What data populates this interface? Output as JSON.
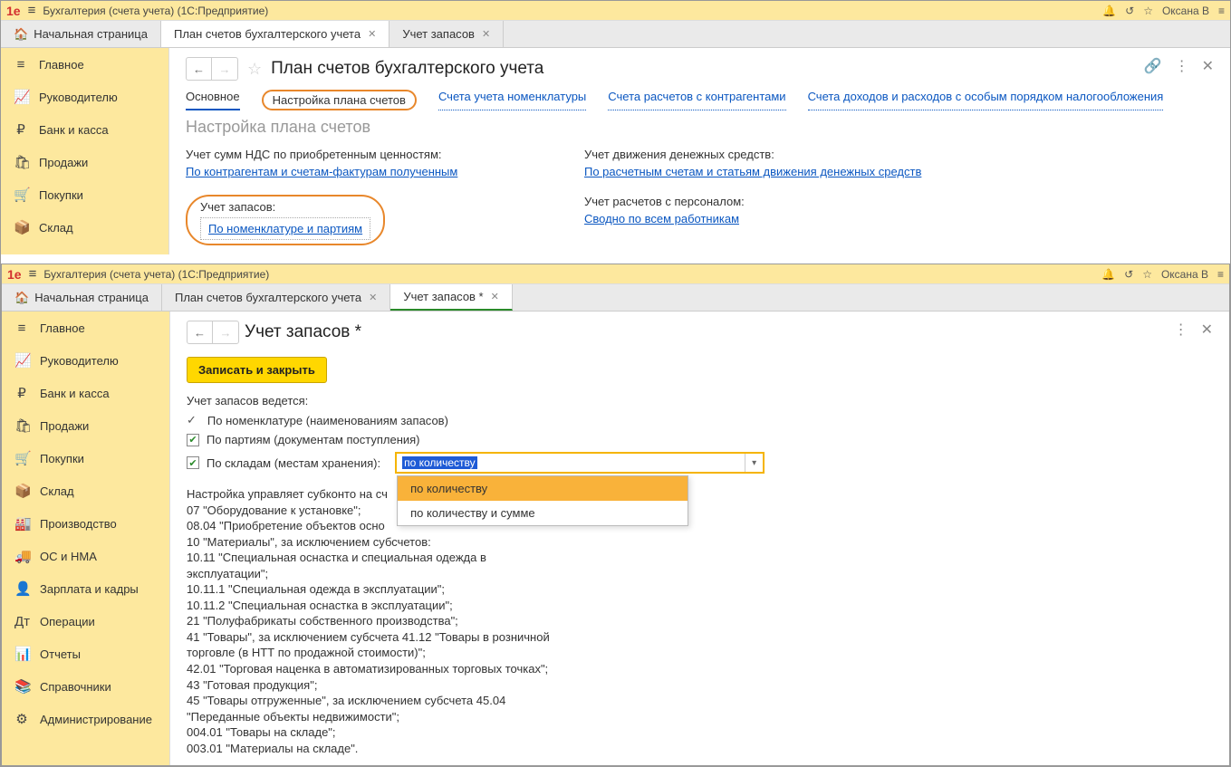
{
  "app": {
    "title": "Бухгалтерия (счета учета)  (1С:Предприятие)",
    "user": "Оксана В"
  },
  "tabs": {
    "home": "Начальная страница",
    "t1": "План счетов бухгалтерского учета",
    "t2": "Учет запасов",
    "t2_mod": "Учет запасов *"
  },
  "sidebar": {
    "main": "Главное",
    "manager": "Руководителю",
    "bank": "Банк и касса",
    "sales": "Продажи",
    "purch": "Покупки",
    "warehouse": "Склад",
    "prod": "Производство",
    "os": "ОС и НМА",
    "salary": "Зарплата и кадры",
    "ops": "Операции",
    "reports": "Отчеты",
    "refs": "Справочники",
    "admin": "Администрирование"
  },
  "page1": {
    "title": "План счетов бухгалтерского учета",
    "subnav": {
      "main": "Основное",
      "setup": "Настройка плана счетов",
      "nomen": "Счета учета номенклатуры",
      "contr": "Счета расчетов с контрагентами",
      "tax": "Счета доходов и расходов с особым порядком налогообложения"
    },
    "section_title": "Настройка плана счетов",
    "nds_label": "Учет сумм НДС по приобретенным ценностям:",
    "nds_link": "По контрагентам и счетам-фактурам полученным",
    "cash_label": "Учет движения денежных средств:",
    "cash_link": "По расчетным счетам и статьям движения денежных средств",
    "stock_label": "Учет запасов:",
    "stock_link": "По номенклатуре и партиям",
    "pers_label": "Учет расчетов с персоналом:",
    "pers_link": "Сводно по всем работникам"
  },
  "page2": {
    "title": "Учет запасов *",
    "save_btn": "Записать и закрыть",
    "header_label": "Учет запасов ведется:",
    "by_nomen": "По номенклатуре (наименованиям запасов)",
    "by_party": "По партиям (документам поступления)",
    "by_warehouse": "По складам (местам хранения):",
    "select_value": "по количеству",
    "dropdown": {
      "opt1": "по количеству",
      "opt2": "по количеству и сумме"
    },
    "info": "Настройка управляет субконто на сч\n07 \"Оборудование к установке\";\n08.04 \"Приобретение объектов осно\n10 \"Материалы\", за исключением субсчетов:\n    10.11 \"Специальная оснастка и специальная одежда в эксплуатации\";\n    10.11.1 \"Специальная одежда в эксплуатации\";\n    10.11.2 \"Специальная оснастка в эксплуатации\";\n21 \"Полуфабрикаты собственного производства\";\n41 \"Товары\", за исключением субсчета 41.12 \"Товары в розничной торговле (в НТТ по продажной стоимости)\";\n42.01 \"Торговая наценка в автоматизированных торговых точках\";\n43 \"Готовая продукция\";\n45 \"Товары отгруженные\", за исключением субсчета 45.04 \"Переданные объекты недвижимости\";\n004.01 \"Товары на складе\";\n003.01 \"Материалы на складе\"."
  }
}
